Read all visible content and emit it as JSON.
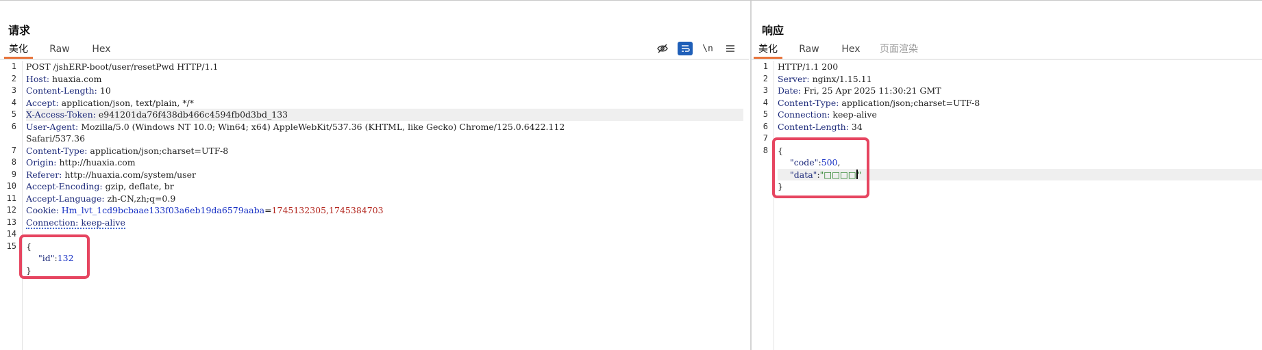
{
  "request": {
    "title": "请求",
    "tabs": [
      {
        "label": "美化",
        "active": true
      },
      {
        "label": "Raw",
        "active": false
      },
      {
        "label": "Hex",
        "active": false
      }
    ],
    "toolbar": {
      "hide_icon": "eye-off-icon",
      "wrap_icon": "word-wrap-icon",
      "newline_label": "\\n",
      "menu_icon": "hamburger-menu-icon"
    },
    "lines": [
      {
        "n": "1",
        "text": "POST /jshERP-boot/user/resetPwd HTTP/1.1"
      },
      {
        "n": "2",
        "key": "Host:",
        "val": " huaxia.com"
      },
      {
        "n": "3",
        "key": "Content-Length:",
        "val": " 10"
      },
      {
        "n": "4",
        "key": "Accept:",
        "val": " application/json, text/plain, */*"
      },
      {
        "n": "5",
        "key": "X-Access-Token:",
        "val": " e941201da76f438db466c4594fb0d3bd_133"
      },
      {
        "n": "6",
        "key": "User-Agent:",
        "val": " Mozilla/5.0 (Windows NT 10.0; Win64; x64) AppleWebKit/537.36 (KHTML, like Gecko) Chrome/125.0.6422.112",
        "wrap": "Safari/537.36"
      },
      {
        "n": "7",
        "key": "Content-Type:",
        "val": " application/json;charset=UTF-8"
      },
      {
        "n": "8",
        "key": "Origin:",
        "val": " http://huaxia.com"
      },
      {
        "n": "9",
        "key": "Referer:",
        "val": " http://huaxia.com/system/user"
      },
      {
        "n": "10",
        "key": "Accept-Encoding:",
        "val": " gzip, deflate, br"
      },
      {
        "n": "11",
        "key": "Accept-Language:",
        "val": " zh-CN,zh;q=0.9"
      },
      {
        "n": "12",
        "key": "Cookie:",
        "ck_name": "Hm_lvt_1cd9bcbaae133f03a6eb19da6579aaba",
        "ck_eq": "=",
        "ck_val": "1745132305,1745384703"
      },
      {
        "n": "13",
        "key": "Connection:",
        "val": " keep-alive"
      },
      {
        "n": "14",
        "text": ""
      },
      {
        "n": "15",
        "text": "{"
      }
    ],
    "body": {
      "open": "{",
      "key": "\"id\"",
      "colon": ":",
      "value": "132",
      "close": "}"
    }
  },
  "response": {
    "title": "响应",
    "tabs": [
      {
        "label": "美化",
        "active": true
      },
      {
        "label": "Raw",
        "active": false
      },
      {
        "label": "Hex",
        "active": false
      },
      {
        "label": "页面渲染",
        "active": false,
        "disabled": true
      }
    ],
    "lines": [
      {
        "n": "1",
        "text": "HTTP/1.1 200"
      },
      {
        "n": "2",
        "key": "Server:",
        "val": " nginx/1.15.11"
      },
      {
        "n": "3",
        "key": "Date:",
        "val": " Fri, 25 Apr 2025 11:30:21 GMT"
      },
      {
        "n": "4",
        "key": "Content-Type:",
        "val": " application/json;charset=UTF-8"
      },
      {
        "n": "5",
        "key": "Connection:",
        "val": " keep-alive"
      },
      {
        "n": "6",
        "key": "Content-Length:",
        "val": " 34"
      },
      {
        "n": "7",
        "text": ""
      },
      {
        "n": "8",
        "text": "{"
      }
    ],
    "body": {
      "open": "{",
      "code_key": "\"code\"",
      "code_colon": ":",
      "code_val": "500",
      "code_comma": ",",
      "data_key": "\"data\"",
      "data_colon": ":",
      "data_val": "\"□□□□",
      "data_close_quote": "\"",
      "close": "}"
    }
  },
  "colors": {
    "active_tab_underline": "#e8743b",
    "highlight_box": "#e64560",
    "header_key": "#1d2a7a",
    "string": "#1a7a1a",
    "number": "#1730c4",
    "cookie_value": "#b3261e"
  }
}
